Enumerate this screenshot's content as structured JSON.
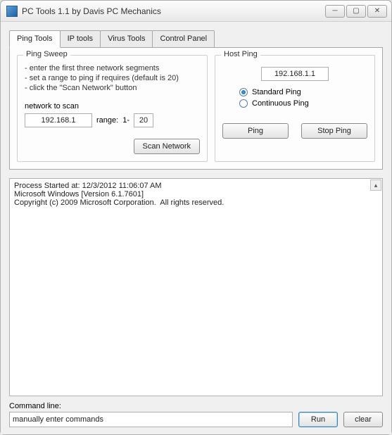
{
  "window": {
    "title": "PC Tools 1.1 by Davis PC Mechanics"
  },
  "tabs": [
    {
      "label": "Ping Tools",
      "active": true
    },
    {
      "label": "IP tools",
      "active": false
    },
    {
      "label": "Virus Tools",
      "active": false
    },
    {
      "label": "Control Panel",
      "active": false
    }
  ],
  "ping_sweep": {
    "legend": "Ping Sweep",
    "instructions": [
      "- enter the first three network segments",
      "- set a range to ping if requires (default is 20)",
      "- click the \"Scan Network\" button"
    ],
    "network_label": "network to scan",
    "network_value": "192.168.1",
    "range_label": "range:",
    "range_prefix": "1-",
    "range_value": "20",
    "scan_button": "Scan Network"
  },
  "host_ping": {
    "legend": "Host Ping",
    "host_value": "192.168.1.1",
    "standard_label": "Standard Ping",
    "continuous_label": "Continuous Ping",
    "selected": "standard",
    "ping_button": "Ping",
    "stop_button": "Stop Ping"
  },
  "output_text": "Process Started at: 12/3/2012 11:06:07 AM\nMicrosoft Windows [Version 6.1.7601]\nCopyright (c) 2009 Microsoft Corporation.  All rights reserved.",
  "command": {
    "label": "Command line:",
    "placeholder": "manually enter commands",
    "value": "manually enter commands",
    "run": "Run",
    "clear": "clear"
  }
}
